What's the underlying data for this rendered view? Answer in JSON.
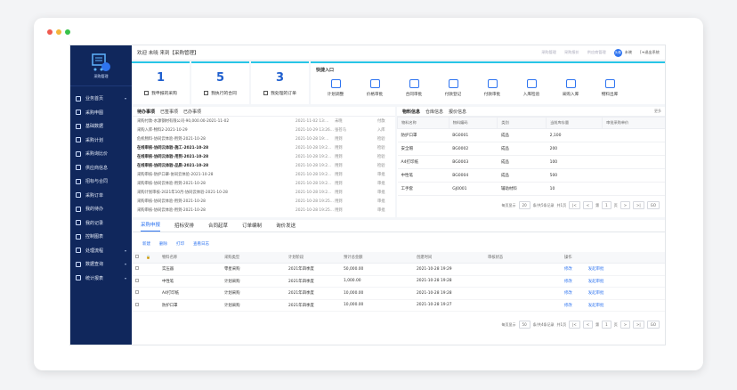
{
  "header": {
    "title": "欢迎 未晓 来到【采购管理】",
    "links": [
      "采购管理",
      "采购报价",
      "供应商管理"
    ],
    "avatar": "头像",
    "user": "未晓",
    "logout": "[➜退出系统"
  },
  "sidebar": {
    "logo_label": "采购管理",
    "items": [
      "业务首页",
      "采购申图",
      "基础数据",
      "采购计划",
      "采购询比价",
      "供应商信息",
      "招标与合同",
      "采购订单",
      "我的待办",
      "我的记录",
      "控制图表",
      "处理流程",
      "数据查询",
      "统计报表"
    ]
  },
  "stats": [
    {
      "value": "1",
      "label": "我申报的采购"
    },
    {
      "value": "5",
      "label": "我执行的合同"
    },
    {
      "value": "3",
      "label": "我处理的订单"
    }
  ],
  "quick": {
    "title": "快捷入口",
    "items": [
      "计划调整",
      "价格审批",
      "合同审批",
      "付款登记",
      "付款审批",
      "入库检验",
      "采购入库",
      "物料出库"
    ]
  },
  "todo": {
    "tabs": [
      "待办事项",
      "已签事项",
      "已办事项"
    ],
    "rows": [
      {
        "t": "采购付款-水源钢材有限公司-90,000.00-2021-11-02",
        "d": "2021-11-02 13:...",
        "u": "未晓",
        "s": "付款",
        "bold": false
      },
      {
        "t": "采购入库-物料2-2021-10-29",
        "d": "2021-10-29 13:26...",
        "u": "张苍马",
        "s": "入库",
        "bold": false
      },
      {
        "t": "危机物料-协同云体验-用到-2021-10-28",
        "d": "2021-10-28 19:...",
        "u": "用到",
        "s": "检验",
        "bold": false
      },
      {
        "t": "在线审核-协同云体验-施工-2021-10-28",
        "d": "2021-10-28 19:2...",
        "u": "用到",
        "s": "检验",
        "bold": true
      },
      {
        "t": "在线审核-协同云体验-用到-2021-10-28",
        "d": "2021-10-28 19:2...",
        "u": "用到",
        "s": "检验",
        "bold": true
      },
      {
        "t": "在线审核-协同云体验-品质-2021-10-28",
        "d": "2021-10-28 19:2...",
        "u": "用到",
        "s": "检验",
        "bold": true
      },
      {
        "t": "采购审核-防护口罩-协同云体验-2021-10-28",
        "d": "2021-10-28 19:2...",
        "u": "用到",
        "s": "审批",
        "bold": false
      },
      {
        "t": "采购审核-协同云体验-用到-2021-10-28",
        "d": "2021-10-28 19:2...",
        "u": "用到",
        "s": "审批",
        "bold": false
      },
      {
        "t": "采购计划审核-2021年10月-协同云体验-2021-10-28",
        "d": "2021-10-28 19:2...",
        "u": "用到",
        "s": "审批",
        "bold": false
      },
      {
        "t": "采购审核-协同云体验-用到-2021-10-28",
        "d": "2021-10-28 19:25...",
        "u": "用到",
        "s": "审批",
        "bold": false
      },
      {
        "t": "采购审核-协同云体验-用到-2021-10-28",
        "d": "2021-10-28 19:25...",
        "u": "用到",
        "s": "审批",
        "bold": false
      }
    ]
  },
  "material": {
    "tabs": [
      "物料信息",
      "仓库信息",
      "报价信息"
    ],
    "more": "更多",
    "headers": [
      "物料名称",
      "物料编码",
      "类别",
      "当前库存量",
      "审批采购单价"
    ],
    "rows": [
      [
        "防护口罩",
        "BG0001",
        "成品",
        "2,100",
        ""
      ],
      [
        "安全帽",
        "BG0002",
        "成品",
        "200",
        ""
      ],
      [
        "A4打印纸",
        "BG0003",
        "成品",
        "100",
        ""
      ],
      [
        "中性笔",
        "BG0004",
        "成品",
        "500",
        ""
      ],
      [
        "工手套",
        "GJ0001",
        "辅助材料",
        "10",
        ""
      ]
    ],
    "pager": {
      "size_label": "每页显示",
      "size": "20",
      "total": "条/共5条记录",
      "pages": "共1页",
      "page_label": "第",
      "page": "1",
      "page_unit": "页",
      "go": "GO"
    }
  },
  "purchase": {
    "tabs": [
      "采购申报",
      "招标安排",
      "合同起草",
      "订单编制",
      "询价发送"
    ],
    "actions": [
      "新建",
      "删除",
      "打印",
      "查看日志"
    ],
    "headers": [
      "",
      "",
      "物料名称",
      "采购类型",
      "计划阶段",
      "预计总金额",
      "创建时间",
      "审核状态",
      "操作"
    ],
    "rows": [
      [
        "实压器",
        "零星采购",
        "2021年四季度",
        "50,000.00",
        "2021-10-28 19:29"
      ],
      [
        "中性笔",
        "计划采购",
        "2021年四季度",
        "1,000.00",
        "2021-10-28 19:28"
      ],
      [
        "A4打印纸",
        "计划采购",
        "2021年四季度",
        "10,000.00",
        "2021-10-28 19:28"
      ],
      [
        "防护口罩",
        "计划采购",
        "2021年四季度",
        "10,000.00",
        "2021-10-28 19:27"
      ]
    ],
    "op1": "修改",
    "op2": "发起审批",
    "pager": {
      "size_label": "每页显示",
      "size": "50",
      "total": "条/共4条记录",
      "pages": "共1页",
      "page_label": "第",
      "page": "1",
      "page_unit": "页",
      "go": "GO"
    }
  }
}
